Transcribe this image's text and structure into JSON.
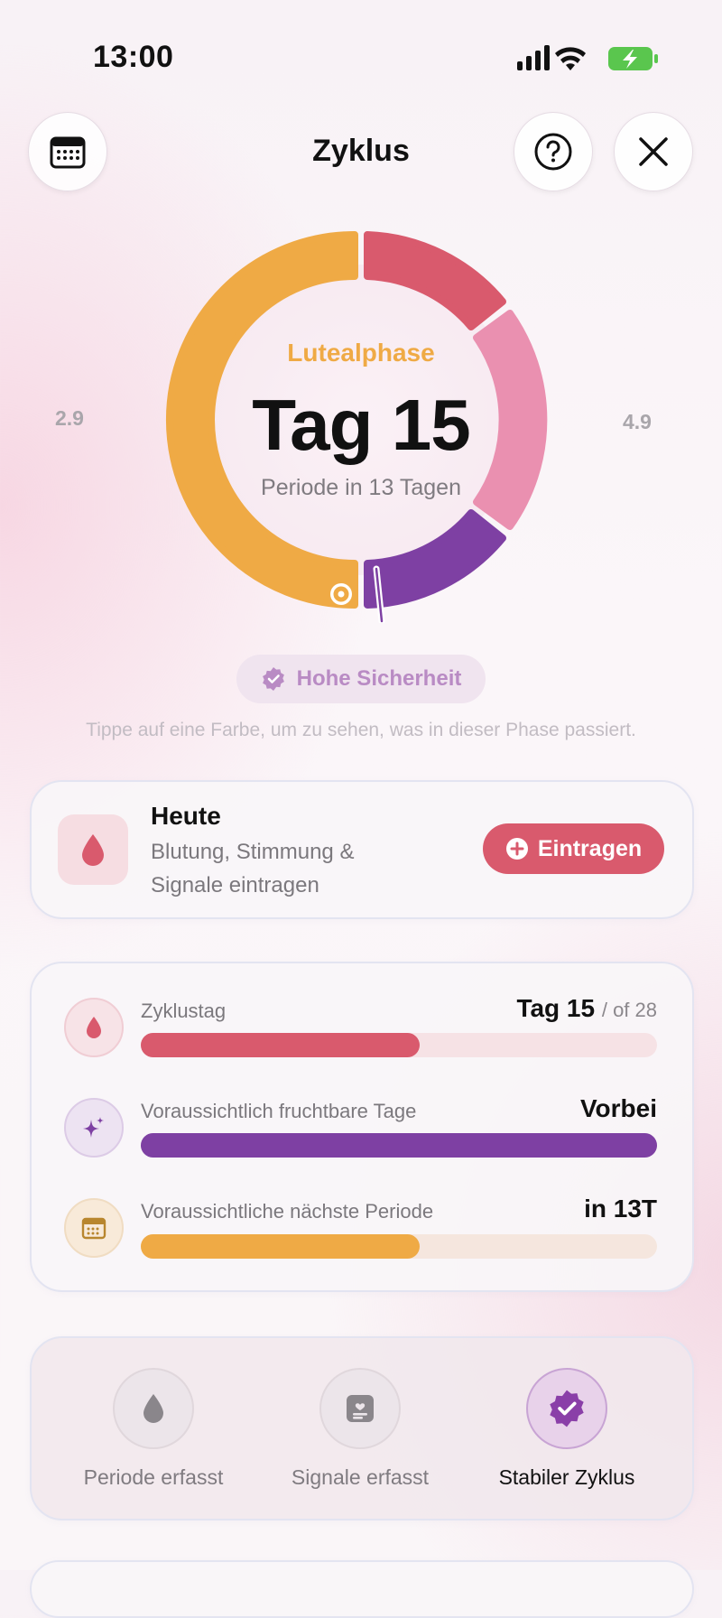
{
  "status_bar": {
    "time": "13:00"
  },
  "header": {
    "title": "Zyklus"
  },
  "ring": {
    "phase": "Lutealphase",
    "day": "Tag 15",
    "subtitle": "Periode in 13 Tagen",
    "start_date": "2.9",
    "end_date": "4.9",
    "colors": {
      "luteal": "#efaa45",
      "period": "#d95a6d",
      "ovulation": "#ea90b0",
      "fertile": "#7e40a3"
    }
  },
  "badge": {
    "label": "Hohe Sicherheit"
  },
  "hint": "Tippe auf eine Farbe, um zu sehen, was in dieser Phase passiert.",
  "today": {
    "title": "Heute",
    "subtitle": "Blutung, Stimmung & Signale eintragen",
    "button": "Eintragen"
  },
  "stats": [
    {
      "label": "Zyklustag",
      "value": "Tag 15",
      "suffix": "/ of 28",
      "progress": 0.54,
      "color": "#d95a6d",
      "track": "#f6e2e5",
      "icon": "drop-icon"
    },
    {
      "label": "Voraussichtlich fruchtbare Tage",
      "value": "Vorbei",
      "suffix": "",
      "progress": 1.0,
      "color": "#7e40a3",
      "track": "#ece2f0",
      "icon": "sparkle-icon"
    },
    {
      "label": "Voraussichtliche nächste Periode",
      "value": "in 13T",
      "suffix": "",
      "progress": 0.54,
      "color": "#efaa45",
      "track": "#f5e6de",
      "icon": "calendar-icon"
    }
  ],
  "achievements": [
    {
      "label": "Periode erfasst",
      "active": false,
      "icon": "drop-icon"
    },
    {
      "label": "Signale erfasst",
      "active": false,
      "icon": "note-icon"
    },
    {
      "label": "Stabiler Zyklus",
      "active": true,
      "icon": "verified-icon"
    }
  ]
}
